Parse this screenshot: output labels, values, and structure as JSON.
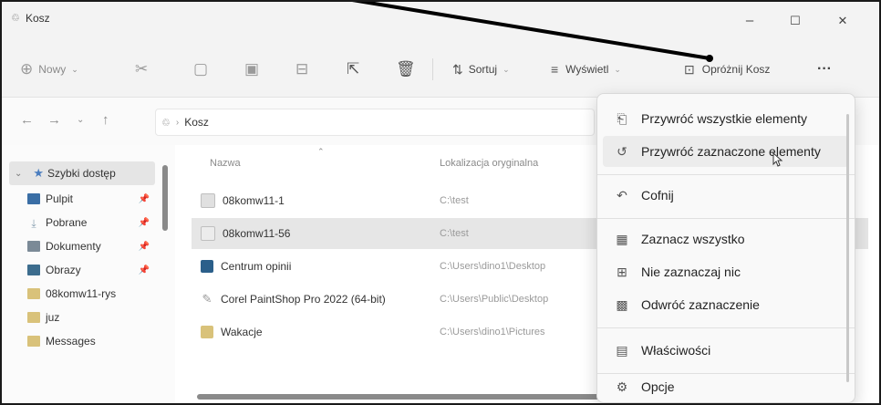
{
  "window": {
    "title": "Kosz",
    "min": "–",
    "max": "☐",
    "close": "✕"
  },
  "toolbar": {
    "new_label": "Nowy",
    "sort_label": "Sortuj",
    "view_label": "Wyświetl",
    "empty_label": "Opróżnij Kosz",
    "more_label": "···"
  },
  "address": {
    "location": "Kosz"
  },
  "sidebar": {
    "quick_access": "Szybki dostęp",
    "items": [
      {
        "label": "Pulpit",
        "icon": "desktop-icon",
        "color": "#3a6ea5"
      },
      {
        "label": "Pobrane",
        "icon": "download-icon",
        "color": "#8aa1b1"
      },
      {
        "label": "Dokumenty",
        "icon": "documents-icon",
        "color": "#7b8a97"
      },
      {
        "label": "Obrazy",
        "icon": "pictures-icon",
        "color": "#3d6d8e"
      },
      {
        "label": "08komw11-rys",
        "icon": "folder-icon",
        "color": "#d9c27a"
      },
      {
        "label": "juz",
        "icon": "folder-icon",
        "color": "#d9c27a"
      },
      {
        "label": "Messages",
        "icon": "folder-icon",
        "color": "#d9c27a"
      }
    ]
  },
  "columns": {
    "name": "Nazwa",
    "location": "Lokalizacja oryginalna"
  },
  "files": [
    {
      "name": "08komw11-1",
      "location": "C:\\test",
      "icon_color": "#bfbfbf"
    },
    {
      "name": "08komw11-56",
      "location": "C:\\test",
      "icon_color": "#bfbfbf"
    },
    {
      "name": "Centrum opinii",
      "location": "C:\\Users\\dino1\\Desktop",
      "icon_color": "#2b5f8a"
    },
    {
      "name": "Corel PaintShop Pro 2022 (64-bit)",
      "location": "C:\\Users\\Public\\Desktop",
      "icon_color": "#a0a0a0"
    },
    {
      "name": "Wakacje",
      "location": "C:\\Users\\dino1\\Pictures",
      "icon_color": "#d9c27a"
    }
  ],
  "menu": {
    "items": [
      {
        "label": "Przywróć wszystkie elementy",
        "icon": "restore-all-icon"
      },
      {
        "label": "Przywróć zaznaczone elementy",
        "icon": "restore-selected-icon"
      },
      {
        "label": "Cofnij",
        "icon": "undo-icon"
      },
      {
        "label": "Zaznacz wszystko",
        "icon": "select-all-icon"
      },
      {
        "label": "Nie zaznaczaj nic",
        "icon": "select-none-icon"
      },
      {
        "label": "Odwróć zaznaczenie",
        "icon": "invert-selection-icon"
      },
      {
        "label": "Właściwości",
        "icon": "properties-icon"
      },
      {
        "label": "Opcje",
        "icon": "options-icon"
      }
    ]
  }
}
